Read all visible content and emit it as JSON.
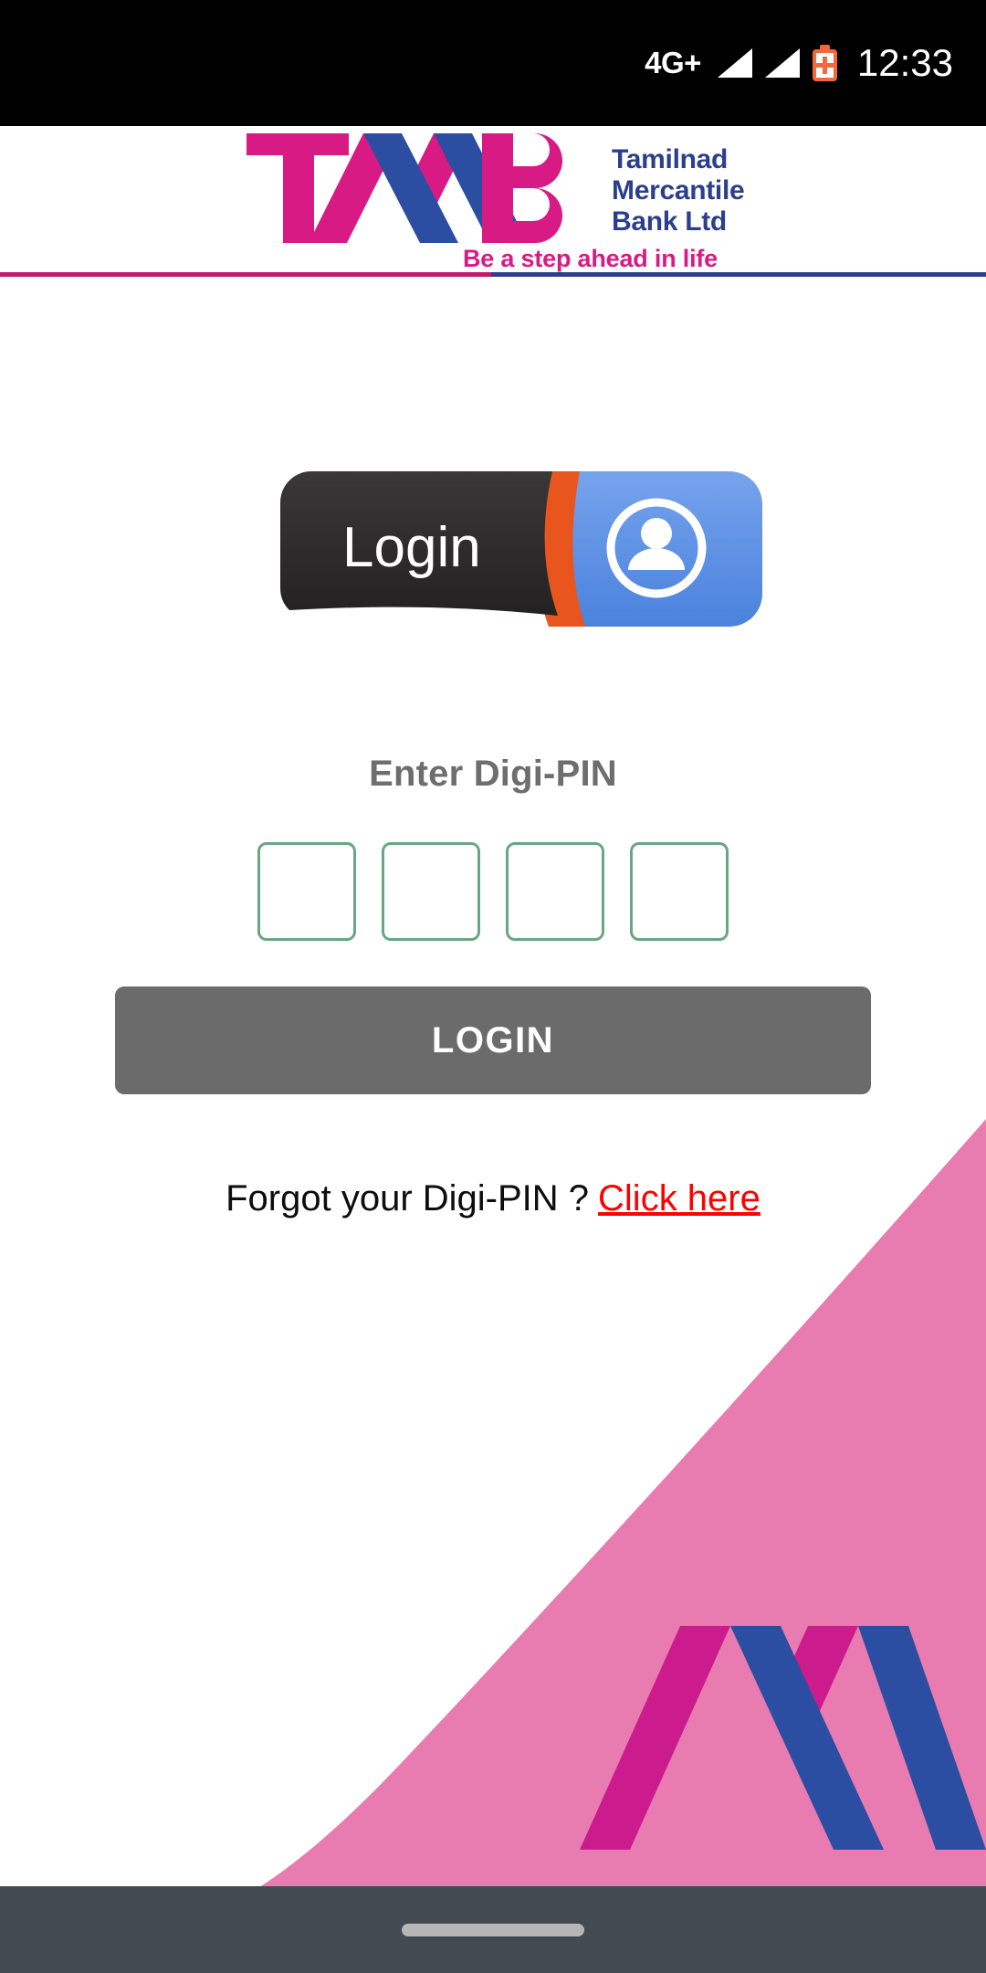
{
  "status_bar": {
    "network": "4G+",
    "time": "12:33",
    "signal_icon_1": "signal-bars-icon",
    "signal_icon_2": "signal-bars-icon",
    "battery_icon": "battery-saver-icon"
  },
  "header": {
    "logo_letters": "TMB",
    "bank_name_line1": "Tamilnad",
    "bank_name_line2": "Mercantile",
    "bank_name_line3": "Bank Ltd",
    "tagline": "Be a step ahead in life",
    "colors": {
      "magenta": "#d81b84",
      "blue": "#2b3f8c",
      "rule_left": "#c2186f",
      "rule_right": "#2b3f8c"
    }
  },
  "banner": {
    "label": "Login",
    "icon": "account-circle-icon",
    "colors": {
      "dark": "#2f2d2e",
      "orange": "#e8561d",
      "blue": "#5b8fe0"
    }
  },
  "pin": {
    "label": "Enter Digi-PIN",
    "digits": [
      "",
      "",
      "",
      ""
    ],
    "placeholder": "",
    "border_color": "#6aa683"
  },
  "login_button": {
    "label": "LOGIN",
    "background": "#6b6b6b",
    "text_color": "#ffffff"
  },
  "forgot": {
    "question": "Forgot your Digi-PIN ?",
    "link_label": "Click here",
    "link_color": "#ff0000"
  },
  "decoration": {
    "wave_color": "#e87bb0",
    "monogram_magenta": "#cc1b8d",
    "monogram_blue": "#2b4ea2"
  },
  "nav_bar": {
    "background": "#434a52",
    "handle": "gesture-pill-handle"
  }
}
